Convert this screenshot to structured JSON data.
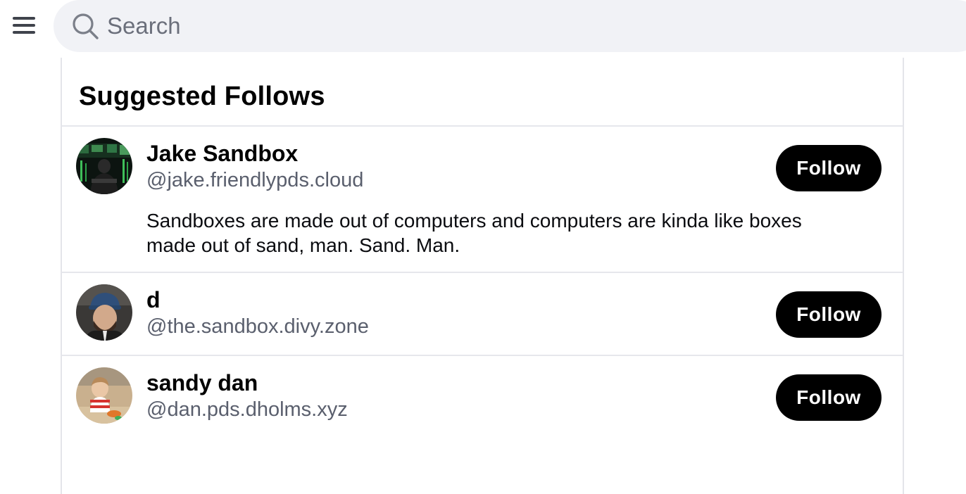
{
  "header": {
    "search_placeholder": "Search"
  },
  "icons": {
    "menu": "hamburger-menu-icon",
    "search": "magnifier-icon"
  },
  "colors": {
    "search_background": "#f1f2f6",
    "placeholder_text": "#6b6f7b",
    "handle_text": "#5a5f6d",
    "follow_button_bg": "#000000",
    "follow_button_text": "#ffffff",
    "divider": "#e6e7ec"
  },
  "suggested": {
    "title": "Suggested Follows",
    "users": [
      {
        "display_name": "Jake Sandbox",
        "handle": "@jake.friendlypds.cloud",
        "bio": "Sandboxes are made out of computers and computers are kinda like boxes made out of sand, man. Sand. Man.",
        "follow_label": "Follow"
      },
      {
        "display_name": "d",
        "handle": "@the.sandbox.divy.zone",
        "follow_label": "Follow"
      },
      {
        "display_name": "sandy dan",
        "handle": "@dan.pds.dholms.xyz",
        "follow_label": "Follow"
      }
    ]
  }
}
